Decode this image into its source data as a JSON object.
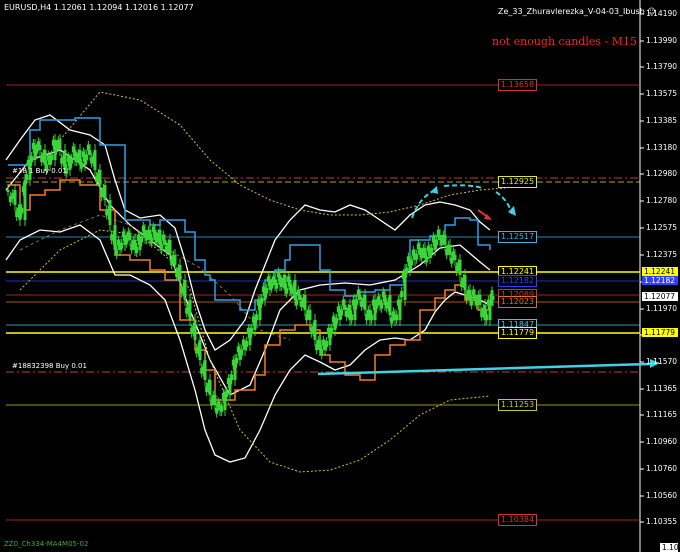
{
  "window": {
    "info": "EURUSD,H4  1.12061 1.12094 1.12016 1.12077",
    "indicator": "Ze_33_Zhuravlerezka_V-04-03_Ibush",
    "warning": "not enough candles - M15",
    "bottom_label": "ZZ0_Ch334-MA4M05-02"
  },
  "price_axis": {
    "ticks": [
      "1.14190",
      "1.13990",
      "1.13790",
      "1.13575",
      "1.13385",
      "1.13180",
      "1.12980",
      "1.12780",
      "1.12575",
      "1.12375",
      "1.12175",
      "1.11970",
      "1.11770",
      "1.11570",
      "1.11365",
      "1.11165",
      "1.10960",
      "1.10760",
      "1.10560",
      "1.10355"
    ],
    "current_price": "1.12077",
    "current_price_color": "#ffffff",
    "small_tag": "1.10"
  },
  "levels": [
    {
      "name": "level-113658",
      "label": "1.13658",
      "color": "#d0342c"
    },
    {
      "name": "level-112925",
      "label": "1.12925",
      "color": "#e0e040"
    },
    {
      "name": "level-112517",
      "label": "1.12517",
      "color": "#30b8e8"
    },
    {
      "name": "level-112241",
      "label": "1.12241",
      "color": "#ffff00"
    },
    {
      "name": "level-112182",
      "label": "1.12182",
      "color": "#3040ff"
    },
    {
      "name": "level-112089",
      "label": "1.12089",
      "color": "#d0342c"
    },
    {
      "name": "level-112023",
      "label": "1.12023",
      "color": "#e07020"
    },
    {
      "name": "level-111847",
      "label": "1.11847",
      "color": "#40c8e0"
    },
    {
      "name": "level-111779",
      "label": "1.11779",
      "color": "#ffff00"
    },
    {
      "name": "level-111253",
      "label": "1.11253",
      "color": "#c8c820"
    },
    {
      "name": "level-110384",
      "label": "1.10384",
      "color": "#d0342c"
    }
  ],
  "orders": [
    {
      "name": "buy-order-top",
      "label": "#18 1 Buy 0.01"
    },
    {
      "name": "buy-order-bottom",
      "label": "#18832398 Buy 0.01"
    }
  ],
  "colors": {
    "background": "#000000",
    "candles": "#39d639",
    "bands": "#ffffff",
    "upper_channel": "#30a0e8",
    "lower_channel": "#f08020",
    "forecast_arrow": "#40d0e8"
  }
}
